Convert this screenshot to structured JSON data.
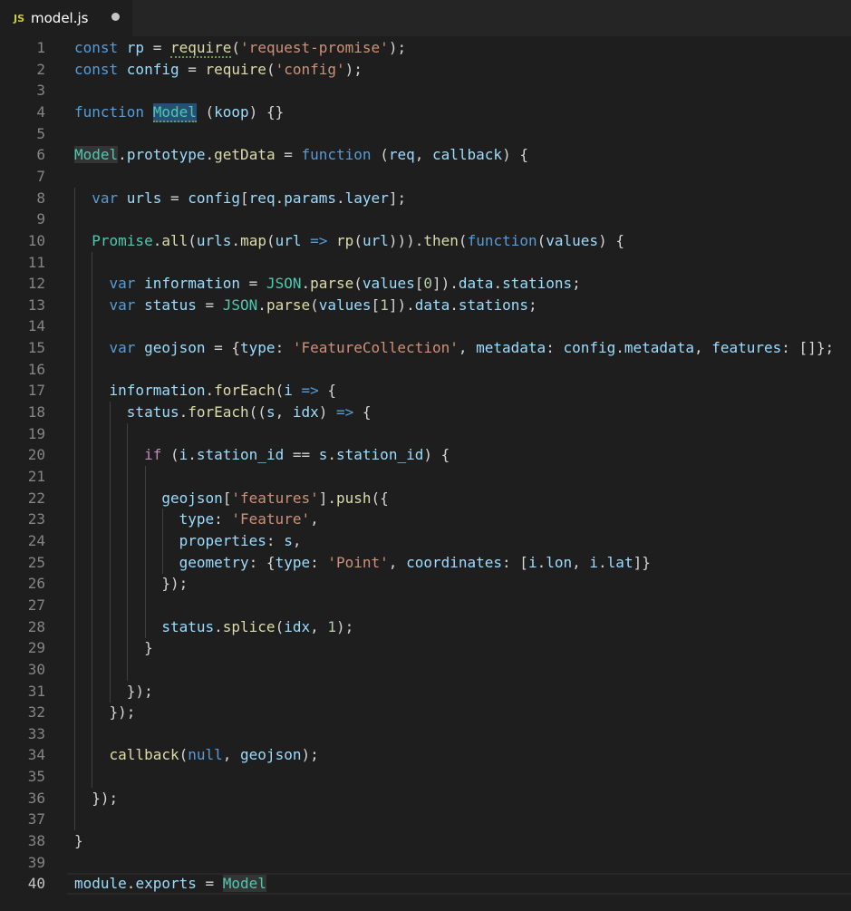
{
  "tab": {
    "icon": "JS",
    "filename": "model.js"
  },
  "editor": {
    "line_numbers": [
      "1",
      "2",
      "3",
      "4",
      "5",
      "6",
      "7",
      "8",
      "9",
      "10",
      "11",
      "12",
      "13",
      "14",
      "15",
      "16",
      "17",
      "18",
      "19",
      "20",
      "21",
      "22",
      "23",
      "24",
      "25",
      "26",
      "27",
      "28",
      "29",
      "30",
      "31",
      "32",
      "33",
      "34",
      "35",
      "36",
      "37",
      "38",
      "39",
      "40"
    ],
    "current_line": "40",
    "lines": [
      [
        [
          "k",
          "const "
        ],
        [
          "v",
          "rp"
        ],
        [
          "p",
          " = "
        ],
        [
          "fn",
          "require"
        ],
        [
          "p",
          "("
        ],
        [
          "s",
          "'request-promise'"
        ],
        [
          "p",
          ");"
        ]
      ],
      [
        [
          "k",
          "const "
        ],
        [
          "v",
          "config"
        ],
        [
          "p",
          " = "
        ],
        [
          "fn",
          "require"
        ],
        [
          "p",
          "("
        ],
        [
          "s",
          "'config'"
        ],
        [
          "p",
          ");"
        ]
      ],
      [],
      [
        [
          "k",
          "function "
        ],
        [
          "t",
          "Model"
        ],
        [
          "p",
          " ("
        ],
        [
          "v",
          "koop"
        ],
        [
          "p",
          ") {}"
        ]
      ],
      [],
      [
        [
          "t",
          "Model"
        ],
        [
          "p",
          "."
        ],
        [
          "v",
          "prototype"
        ],
        [
          "p",
          "."
        ],
        [
          "fn",
          "getData"
        ],
        [
          "p",
          " = "
        ],
        [
          "k",
          "function"
        ],
        [
          "p",
          " ("
        ],
        [
          "v",
          "req"
        ],
        [
          "p",
          ", "
        ],
        [
          "v",
          "callback"
        ],
        [
          "p",
          ") {"
        ]
      ],
      [],
      [
        [
          "p",
          "  "
        ],
        [
          "k",
          "var "
        ],
        [
          "v",
          "urls"
        ],
        [
          "p",
          " = "
        ],
        [
          "v",
          "config"
        ],
        [
          "p",
          "["
        ],
        [
          "v",
          "req"
        ],
        [
          "p",
          "."
        ],
        [
          "v",
          "params"
        ],
        [
          "p",
          "."
        ],
        [
          "v",
          "layer"
        ],
        [
          "p",
          "];"
        ]
      ],
      [],
      [
        [
          "p",
          "  "
        ],
        [
          "t",
          "Promise"
        ],
        [
          "p",
          "."
        ],
        [
          "fn",
          "all"
        ],
        [
          "p",
          "("
        ],
        [
          "v",
          "urls"
        ],
        [
          "p",
          "."
        ],
        [
          "fn",
          "map"
        ],
        [
          "p",
          "("
        ],
        [
          "v",
          "url"
        ],
        [
          "k",
          " => "
        ],
        [
          "fn",
          "rp"
        ],
        [
          "p",
          "("
        ],
        [
          "v",
          "url"
        ],
        [
          "p",
          ")))."
        ],
        [
          "fn",
          "then"
        ],
        [
          "p",
          "("
        ],
        [
          "k",
          "function"
        ],
        [
          "p",
          "("
        ],
        [
          "v",
          "values"
        ],
        [
          "p",
          ") {"
        ]
      ],
      [],
      [
        [
          "p",
          "    "
        ],
        [
          "k",
          "var "
        ],
        [
          "v",
          "information"
        ],
        [
          "p",
          " = "
        ],
        [
          "t",
          "JSON"
        ],
        [
          "p",
          "."
        ],
        [
          "fn",
          "parse"
        ],
        [
          "p",
          "("
        ],
        [
          "v",
          "values"
        ],
        [
          "p",
          "["
        ],
        [
          "n",
          "0"
        ],
        [
          "p",
          "])."
        ],
        [
          "v",
          "data"
        ],
        [
          "p",
          "."
        ],
        [
          "v",
          "stations"
        ],
        [
          "p",
          ";"
        ]
      ],
      [
        [
          "p",
          "    "
        ],
        [
          "k",
          "var "
        ],
        [
          "v",
          "status"
        ],
        [
          "p",
          " = "
        ],
        [
          "t",
          "JSON"
        ],
        [
          "p",
          "."
        ],
        [
          "fn",
          "parse"
        ],
        [
          "p",
          "("
        ],
        [
          "v",
          "values"
        ],
        [
          "p",
          "["
        ],
        [
          "n",
          "1"
        ],
        [
          "p",
          "])."
        ],
        [
          "v",
          "data"
        ],
        [
          "p",
          "."
        ],
        [
          "v",
          "stations"
        ],
        [
          "p",
          ";"
        ]
      ],
      [],
      [
        [
          "p",
          "    "
        ],
        [
          "k",
          "var "
        ],
        [
          "v",
          "geojson"
        ],
        [
          "p",
          " = {"
        ],
        [
          "v",
          "type"
        ],
        [
          "p",
          ": "
        ],
        [
          "s",
          "'FeatureCollection'"
        ],
        [
          "p",
          ", "
        ],
        [
          "v",
          "metadata"
        ],
        [
          "p",
          ": "
        ],
        [
          "v",
          "config"
        ],
        [
          "p",
          "."
        ],
        [
          "v",
          "metadata"
        ],
        [
          "p",
          ", "
        ],
        [
          "v",
          "features"
        ],
        [
          "p",
          ": []};"
        ]
      ],
      [],
      [
        [
          "p",
          "    "
        ],
        [
          "v",
          "information"
        ],
        [
          "p",
          "."
        ],
        [
          "fn",
          "forEach"
        ],
        [
          "p",
          "("
        ],
        [
          "v",
          "i"
        ],
        [
          "k",
          " =>"
        ],
        [
          "p",
          " {"
        ]
      ],
      [
        [
          "p",
          "      "
        ],
        [
          "v",
          "status"
        ],
        [
          "p",
          "."
        ],
        [
          "fn",
          "forEach"
        ],
        [
          "p",
          "(("
        ],
        [
          "v",
          "s"
        ],
        [
          "p",
          ", "
        ],
        [
          "v",
          "idx"
        ],
        [
          "p",
          ")"
        ],
        [
          "k",
          " =>"
        ],
        [
          "p",
          " {"
        ]
      ],
      [],
      [
        [
          "p",
          "        "
        ],
        [
          "kc",
          "if"
        ],
        [
          "p",
          " ("
        ],
        [
          "v",
          "i"
        ],
        [
          "p",
          "."
        ],
        [
          "v",
          "station_id"
        ],
        [
          "p",
          " == "
        ],
        [
          "v",
          "s"
        ],
        [
          "p",
          "."
        ],
        [
          "v",
          "station_id"
        ],
        [
          "p",
          ") {"
        ]
      ],
      [],
      [
        [
          "p",
          "          "
        ],
        [
          "v",
          "geojson"
        ],
        [
          "p",
          "["
        ],
        [
          "s",
          "'features'"
        ],
        [
          "p",
          "]."
        ],
        [
          "fn",
          "push"
        ],
        [
          "p",
          "({"
        ]
      ],
      [
        [
          "p",
          "            "
        ],
        [
          "v",
          "type"
        ],
        [
          "p",
          ": "
        ],
        [
          "s",
          "'Feature'"
        ],
        [
          "p",
          ","
        ]
      ],
      [
        [
          "p",
          "            "
        ],
        [
          "v",
          "properties"
        ],
        [
          "p",
          ": "
        ],
        [
          "v",
          "s"
        ],
        [
          "p",
          ","
        ]
      ],
      [
        [
          "p",
          "            "
        ],
        [
          "v",
          "geometry"
        ],
        [
          "p",
          ": {"
        ],
        [
          "v",
          "type"
        ],
        [
          "p",
          ": "
        ],
        [
          "s",
          "'Point'"
        ],
        [
          "p",
          ", "
        ],
        [
          "v",
          "coordinates"
        ],
        [
          "p",
          ": ["
        ],
        [
          "v",
          "i"
        ],
        [
          "p",
          "."
        ],
        [
          "v",
          "lon"
        ],
        [
          "p",
          ", "
        ],
        [
          "v",
          "i"
        ],
        [
          "p",
          "."
        ],
        [
          "v",
          "lat"
        ],
        [
          "p",
          "]}"
        ]
      ],
      [
        [
          "p",
          "          });"
        ]
      ],
      [],
      [
        [
          "p",
          "          "
        ],
        [
          "v",
          "status"
        ],
        [
          "p",
          "."
        ],
        [
          "fn",
          "splice"
        ],
        [
          "p",
          "("
        ],
        [
          "v",
          "idx"
        ],
        [
          "p",
          ", "
        ],
        [
          "n",
          "1"
        ],
        [
          "p",
          ");"
        ]
      ],
      [
        [
          "p",
          "        }"
        ]
      ],
      [],
      [
        [
          "p",
          "      });"
        ]
      ],
      [
        [
          "p",
          "    });"
        ]
      ],
      [],
      [
        [
          "p",
          "    "
        ],
        [
          "fn",
          "callback"
        ],
        [
          "p",
          "("
        ],
        [
          "k",
          "null"
        ],
        [
          "p",
          ", "
        ],
        [
          "v",
          "geojson"
        ],
        [
          "p",
          ");"
        ]
      ],
      [],
      [
        [
          "p",
          "  });"
        ]
      ],
      [],
      [
        [
          "p",
          "}"
        ]
      ],
      [],
      [
        [
          "v",
          "module"
        ],
        [
          "p",
          "."
        ],
        [
          "v",
          "exports"
        ],
        [
          "p",
          " = "
        ],
        [
          "t",
          "Model"
        ]
      ]
    ]
  }
}
